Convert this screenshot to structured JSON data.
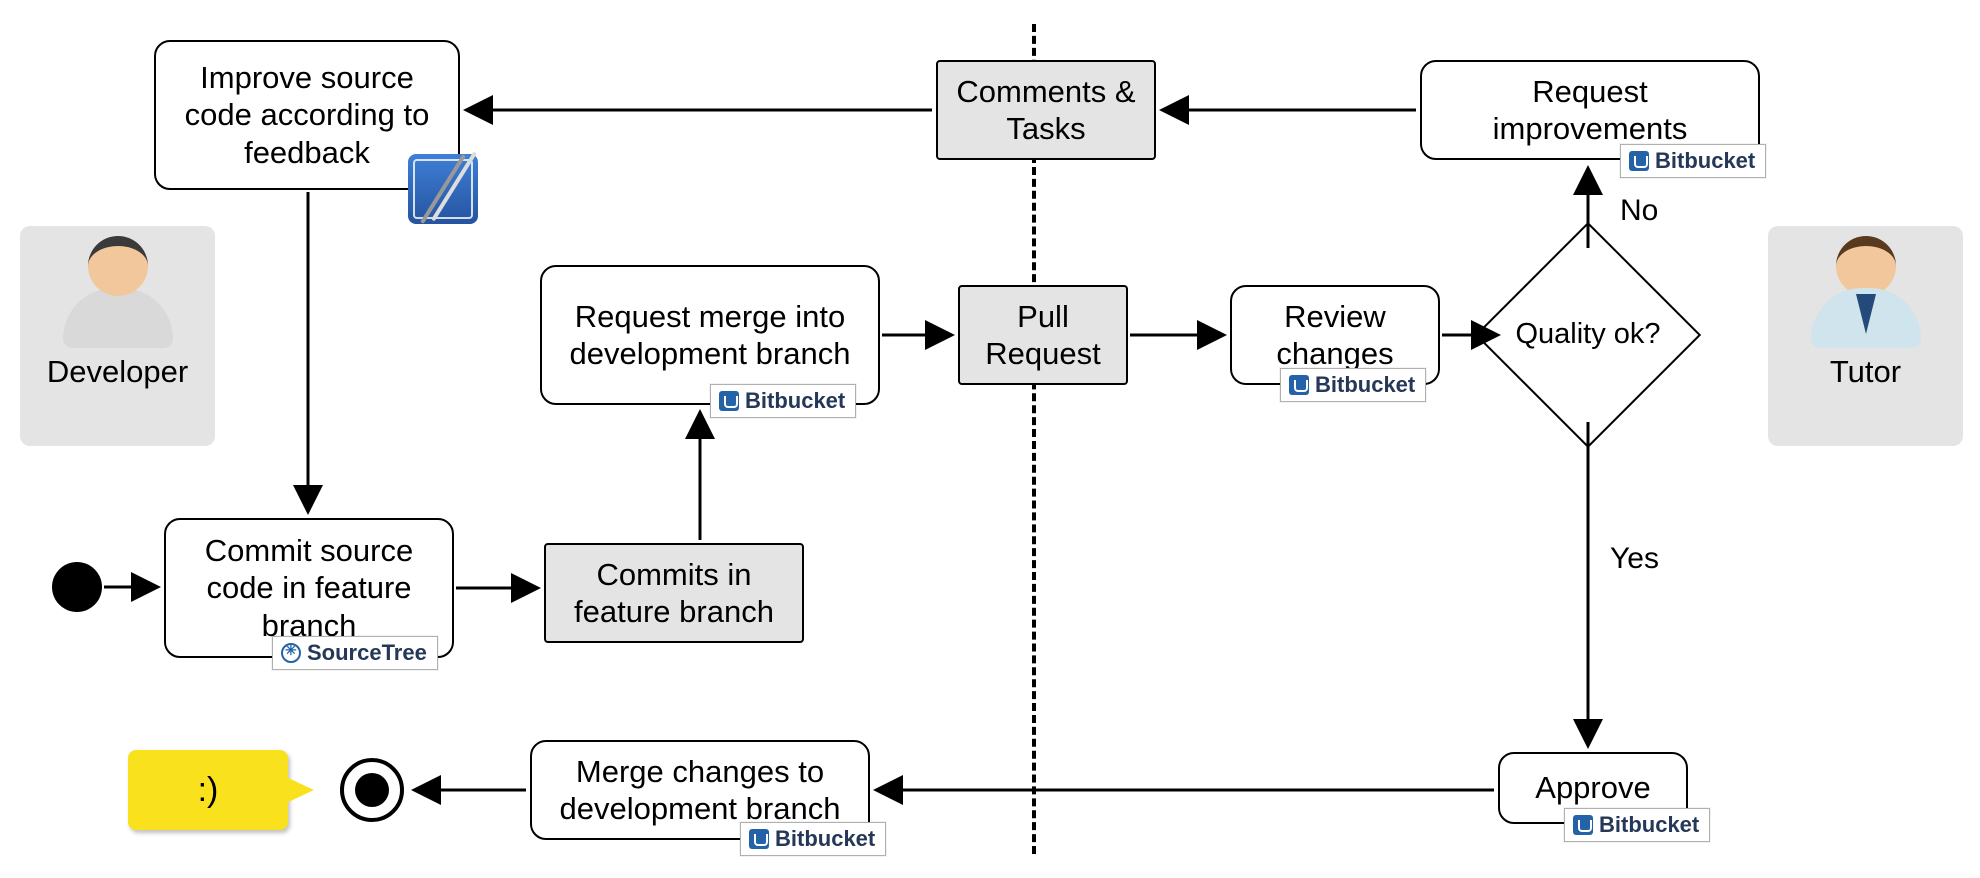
{
  "actors": {
    "developer": "Developer",
    "tutor": "Tutor"
  },
  "nodes": {
    "improve": "Improve source code according to feedback",
    "commit": "Commit source code in feature branch",
    "commitsObj": "Commits in feature branch",
    "requestMerge": "Request merge into development branch",
    "pullRequest": "Pull Request",
    "commentsTasks": "Comments & Tasks",
    "reviewChanges": "Review changes",
    "qualityOk": "Quality ok?",
    "requestImprovements": "Request improvements",
    "approve": "Approve",
    "merge": "Merge changes to development branch"
  },
  "edgeLabels": {
    "no": "No",
    "yes": "Yes"
  },
  "tools": {
    "bitbucket": "Bitbucket",
    "sourcetree": "SourceTree"
  },
  "speech": ":)"
}
